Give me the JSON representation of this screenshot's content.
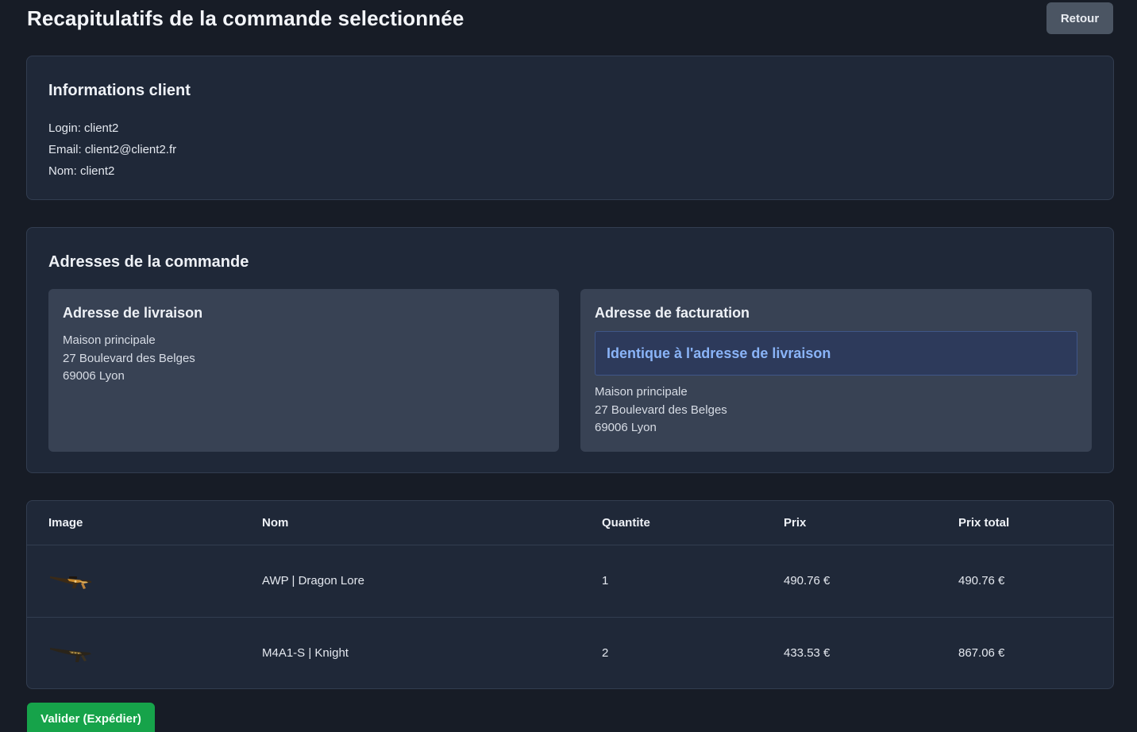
{
  "header": {
    "title": "Recapitulatifs de la commande selectionnée",
    "back_label": "Retour"
  },
  "client": {
    "heading": "Informations client",
    "lines": [
      "Login: client2",
      "Email: client2@client2.fr",
      "Nom: client2"
    ]
  },
  "addresses": {
    "heading": "Adresses de la commande",
    "delivery": {
      "heading": "Adresse de livraison",
      "lines": [
        "Maison principale",
        "27 Boulevard des Belges",
        "69006 Lyon"
      ]
    },
    "billing": {
      "heading": "Adresse de facturation",
      "same_notice": "Identique à l'adresse de livraison",
      "lines": [
        "Maison principale",
        "27 Boulevard des Belges",
        "69006 Lyon"
      ]
    }
  },
  "items_table": {
    "columns": [
      "Image",
      "Nom",
      "Quantite",
      "Prix",
      "Prix total"
    ],
    "rows": [
      {
        "name": "AWP | Dragon Lore",
        "quantity": "1",
        "price": "490.76 €",
        "total": "490.76 €",
        "image_icon": "awp-rifle-icon"
      },
      {
        "name": "M4A1-S | Knight",
        "quantity": "2",
        "price": "433.53 €",
        "total": "867.06 €",
        "image_icon": "m4a1s-rifle-icon"
      }
    ]
  },
  "actions": {
    "validate_label": "Valider (Expédier)"
  },
  "colors": {
    "background": "#171c26",
    "card": "#1f2838",
    "address_box": "#384254",
    "notice_text": "#8ab4f8",
    "validate_button": "#16a34a",
    "back_button": "#4b5563"
  }
}
